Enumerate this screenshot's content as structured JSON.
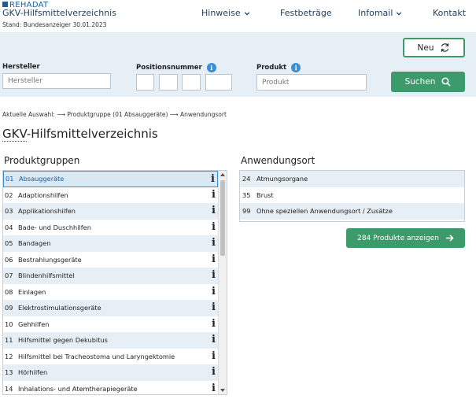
{
  "brand": {
    "logo_text": "REHADAT",
    "title": "GKV-Hilfsmittelverzeichnis",
    "stand": "Stand: Bundesanzeiger 30.01.2023"
  },
  "nav": {
    "hinweise": "Hinweise",
    "festbetraege": "Festbeträge",
    "infomail": "Infomail",
    "kontakt": "Kontakt"
  },
  "search": {
    "hersteller_label": "Hersteller",
    "hersteller_placeholder": "Hersteller",
    "position_label": "Positionsnummer",
    "produkt_label": "Produkt",
    "produkt_placeholder": "Produkt",
    "neu_label": "Neu",
    "suchen_label": "Suchen",
    "info_glyph": "i"
  },
  "breadcrumb": "Aktuelle Auswahl: ⟶ Produktgruppe (01 Absauggeräte) ⟶ Anwendungsort",
  "page_title": {
    "abbr": "GKV",
    "rest": "-Hilfsmittelverzeichnis"
  },
  "produktgruppen": {
    "heading": "Produktgruppen",
    "items": [
      {
        "code": "01",
        "name": "Absauggeräte",
        "selected": true
      },
      {
        "code": "02",
        "name": "Adaptionshilfen"
      },
      {
        "code": "03",
        "name": "Applikationshilfen"
      },
      {
        "code": "04",
        "name": "Bade- und Duschhilfen"
      },
      {
        "code": "05",
        "name": "Bandagen"
      },
      {
        "code": "06",
        "name": "Bestrahlungsgeräte"
      },
      {
        "code": "07",
        "name": "Blindenhilfsmittel"
      },
      {
        "code": "08",
        "name": "Einlagen"
      },
      {
        "code": "09",
        "name": "Elektrostimulationsgeräte"
      },
      {
        "code": "10",
        "name": "Gehhilfen"
      },
      {
        "code": "11",
        "name": "Hilfsmittel gegen Dekubitus"
      },
      {
        "code": "12",
        "name": "Hilfsmittel bei Tracheostoma und Laryngektomie"
      },
      {
        "code": "13",
        "name": "Hörhilfen"
      },
      {
        "code": "14",
        "name": "Inhalations- und Atemtherapiegeräte"
      }
    ],
    "info_glyph": "i"
  },
  "anwendungsort": {
    "heading": "Anwendungsort",
    "items": [
      {
        "code": "24",
        "name": "Atmungsorgane"
      },
      {
        "code": "35",
        "name": "Brust"
      },
      {
        "code": "99",
        "name": "Ohne speziellen Anwendungsort / Zusätze"
      }
    ]
  },
  "show_products_label": "284 Produkte anzeigen",
  "colors": {
    "accent_green": "#3d9b6b",
    "panel_bg": "#e6eff5",
    "brand_blue": "#1a5fa0",
    "info_blue": "#3a8ed3"
  }
}
